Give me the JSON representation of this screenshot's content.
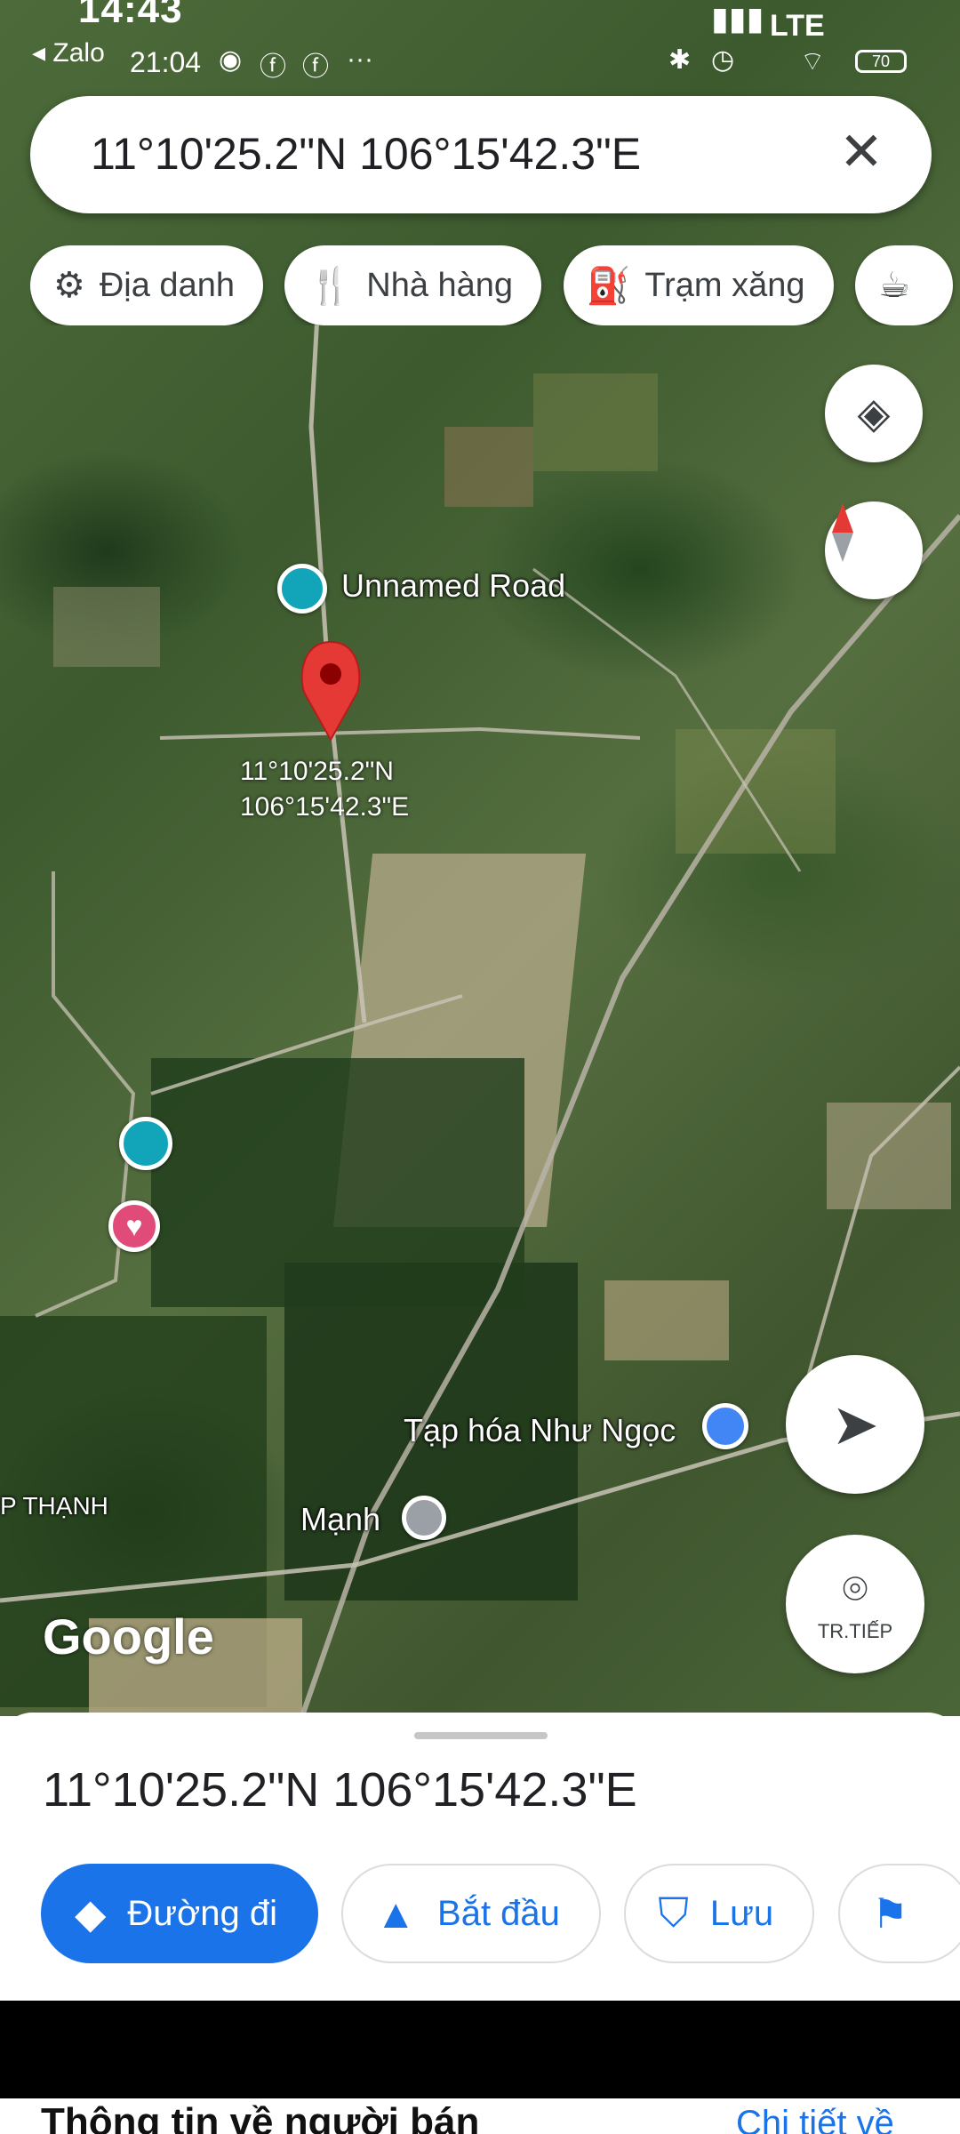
{
  "status_bar": {
    "time": "14:43",
    "app_label": "Zalo",
    "clock": "21:04",
    "network": "LTE",
    "battery": "70",
    "icons": [
      "messenger-icon",
      "facebook-icon",
      "facebook-icon",
      "more-dots-icon",
      "bluetooth-icon",
      "alarm-icon",
      "wifi-icon"
    ]
  },
  "search": {
    "query": "11°10'25.2\"N 106°15'42.3\"E",
    "clear_icon": "close-icon"
  },
  "chips": [
    {
      "label": "Địa danh",
      "icon": "landmark-icon"
    },
    {
      "label": "Nhà hàng",
      "icon": "restaurant-icon"
    },
    {
      "label": "Trạm xăng",
      "icon": "gas-station-icon"
    },
    {
      "label": "",
      "icon": "coffee-icon"
    }
  ],
  "map": {
    "road_label": "Unnamed Road",
    "pin_coords_line1": "11°10'25.2\"N",
    "pin_coords_line2": "106°15'42.3\"E",
    "poi_shop": "Tạp hóa Như Ngọc",
    "poi_manh": "Mạnh",
    "area_label": "P THẠNH",
    "attribution": "Google",
    "pin_color": "#e53935",
    "accent_color": "#1a73e8"
  },
  "controls": {
    "layers_icon": "layers-icon",
    "compass_icon": "compass-icon",
    "navigate_icon": "navigation-arrow-icon",
    "live_label": "TR.TIẾP"
  },
  "sheet": {
    "title": "11°10'25.2\"N 106°15'42.3\"E",
    "actions": [
      {
        "label": "Đường đi",
        "icon": "directions-icon",
        "primary": true
      },
      {
        "label": "Bắt đầu",
        "icon": "start-arrow-icon",
        "primary": false
      },
      {
        "label": "Lưu",
        "icon": "bookmark-icon",
        "primary": false
      },
      {
        "label": "",
        "icon": "flag-icon",
        "primary": false
      }
    ]
  },
  "footer": {
    "seller_title": "Thông tin về người bán",
    "seller_more": "Chi tiết về"
  }
}
